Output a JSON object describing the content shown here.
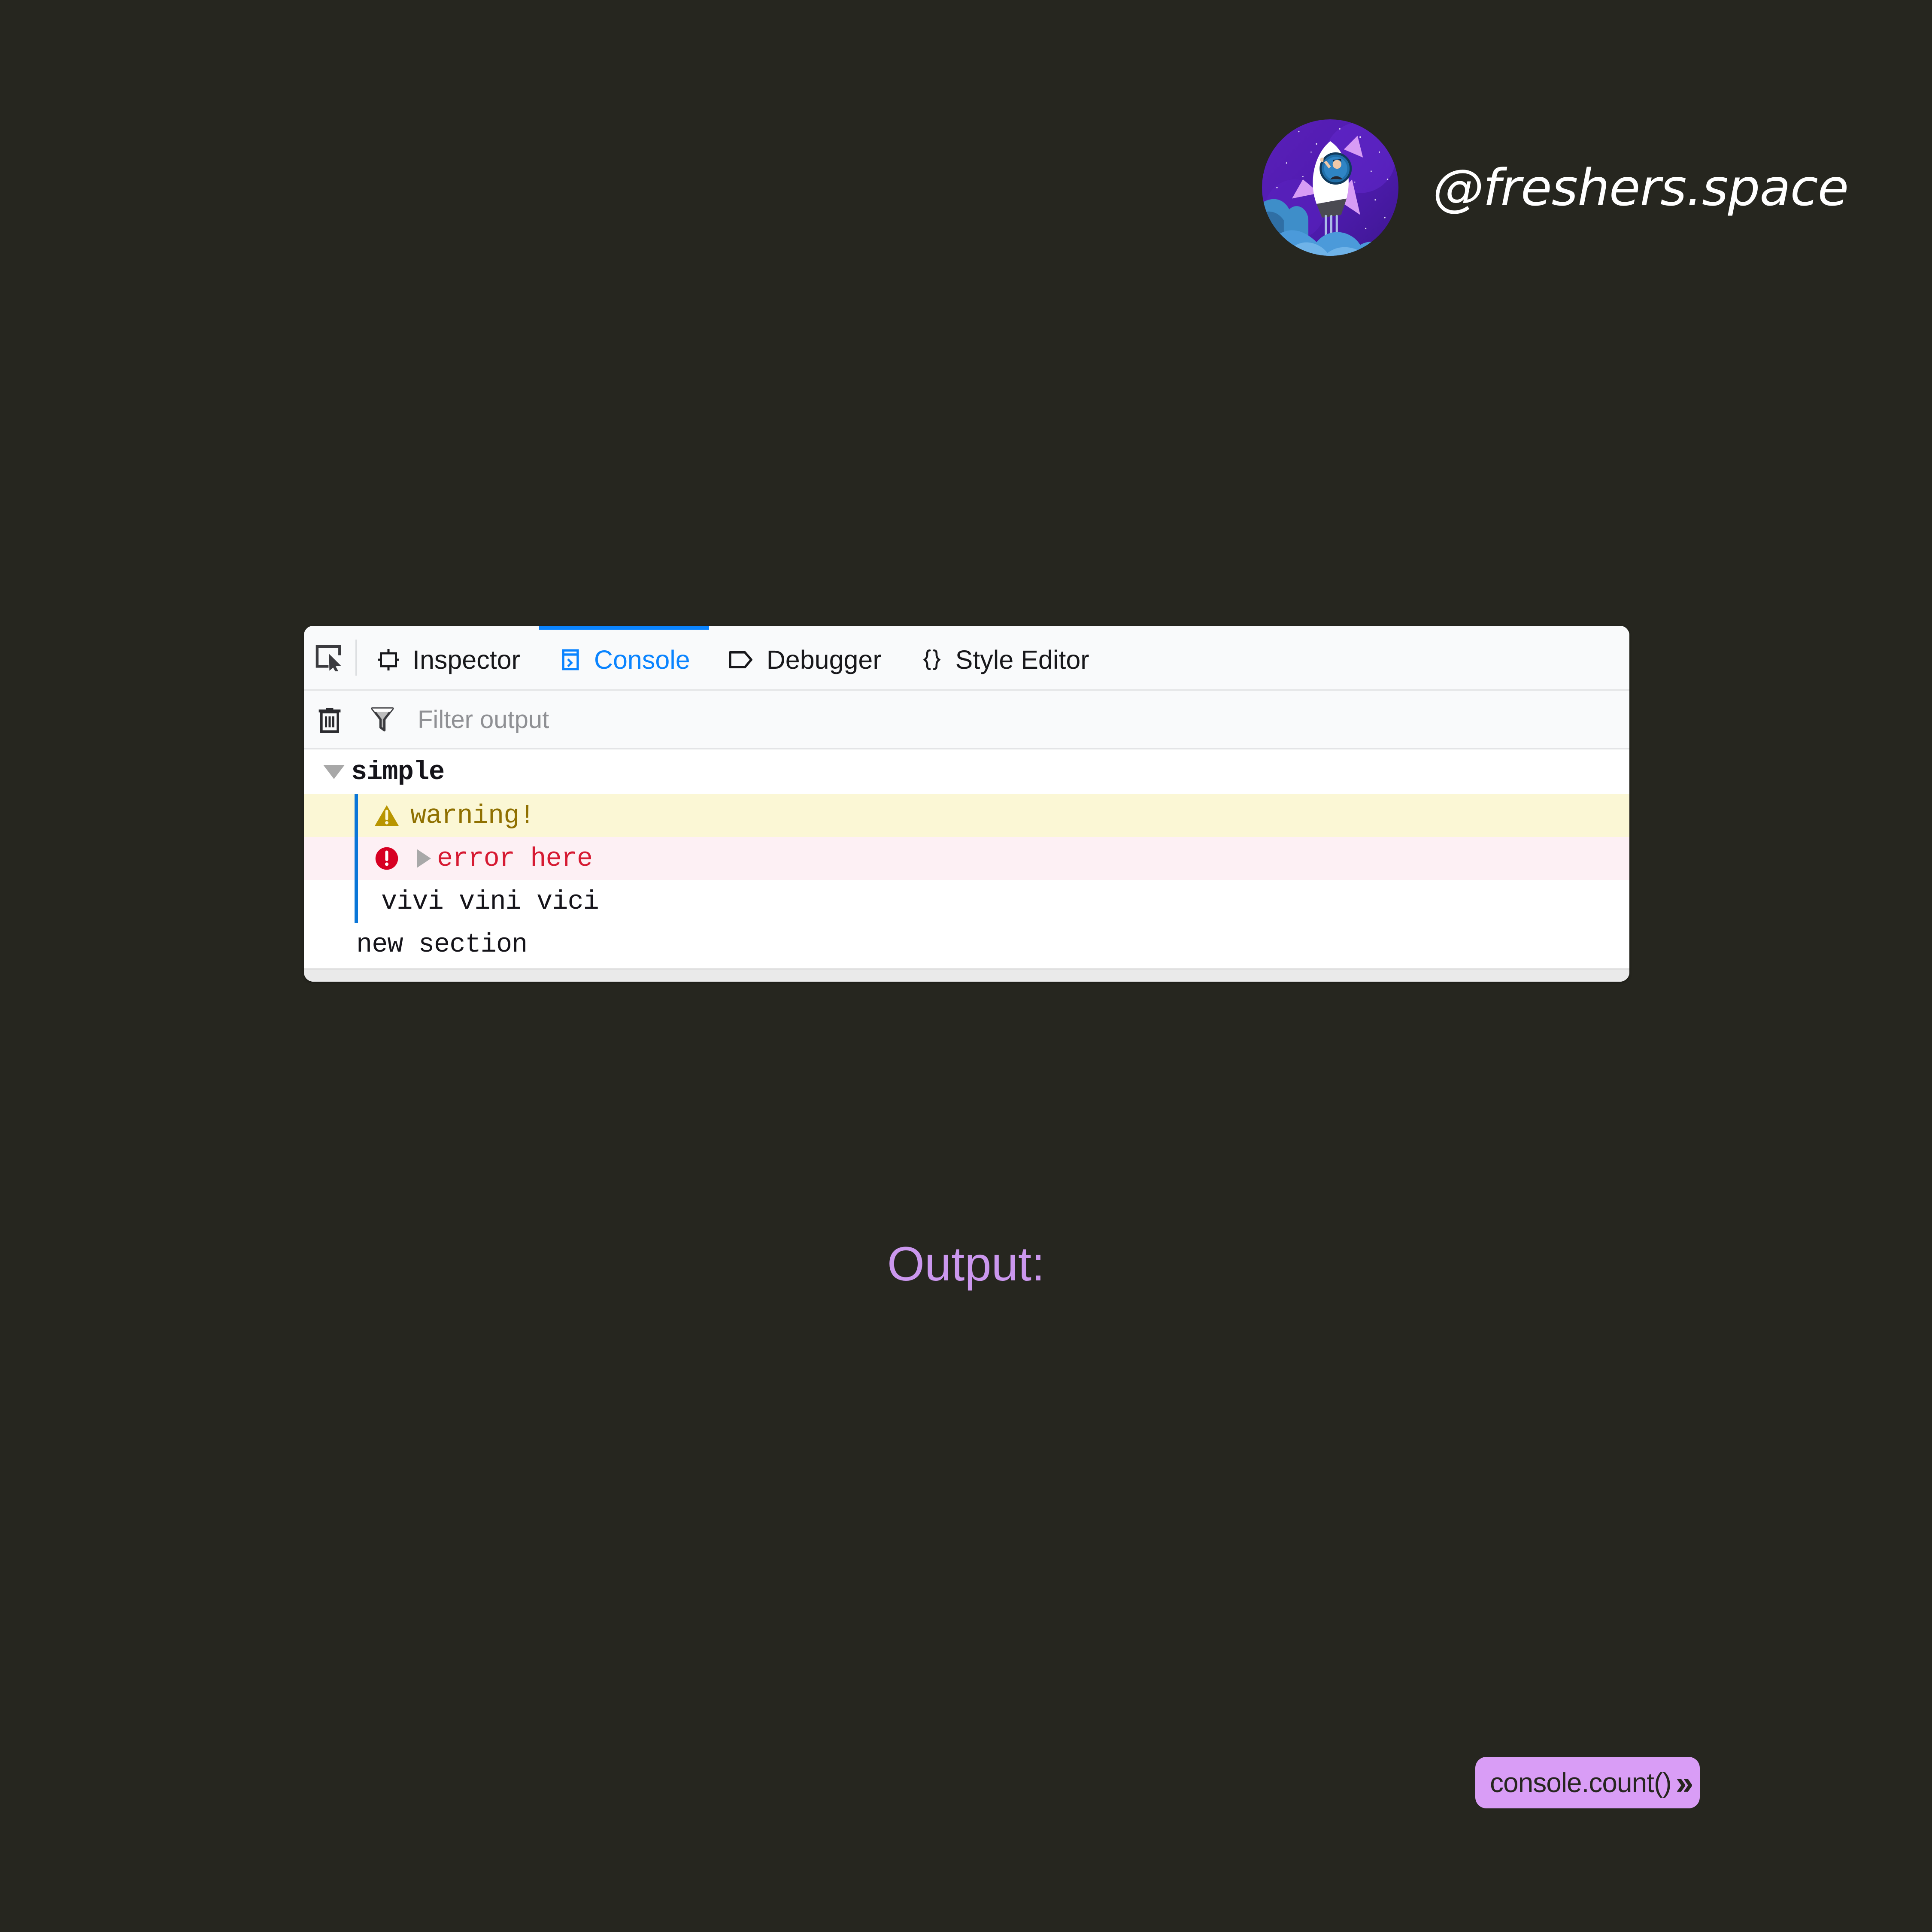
{
  "watermark": {
    "handle": "@freshers.space",
    "avatar_alt": "rocket-avatar"
  },
  "devtools": {
    "picker_icon": "element-picker-icon",
    "tabs": [
      {
        "label": "Inspector",
        "icon": "inspector-box-icon",
        "active": false
      },
      {
        "label": "Console",
        "icon": "console-window-icon",
        "active": true
      },
      {
        "label": "Debugger",
        "icon": "debugger-pentagon-icon",
        "active": false
      },
      {
        "label": "Style Editor",
        "icon": "curly-braces-icon",
        "active": false
      }
    ],
    "toolbar": {
      "clear_icon": "trash-icon",
      "filter_icon": "funnel-icon",
      "filter_placeholder": "Filter output",
      "filter_value": ""
    },
    "console_rows": [
      {
        "kind": "group",
        "caret": "caret-down",
        "text": "simple"
      },
      {
        "kind": "warning",
        "icon": "warning-triangle-icon",
        "text": "warning!"
      },
      {
        "kind": "error",
        "icon": "error-circle-icon",
        "caret": "caret-right",
        "text": "error here"
      },
      {
        "kind": "log",
        "text": "vivi vini vici"
      },
      {
        "kind": "log-outer",
        "text": "new section"
      }
    ],
    "colors": {
      "accent_blue": "#0a84ff",
      "group_line": "#0a76d8",
      "warning_bg": "#fbf7d5",
      "warning_fg": "#8f7000",
      "error_bg": "#fdf0f4",
      "error_fg": "#d61a32"
    }
  },
  "caption": {
    "text": "Output:"
  },
  "cta": {
    "label": "console.count()",
    "chevrons": "››",
    "bg": "#d99df6"
  },
  "page": {
    "background": "#26261f"
  }
}
